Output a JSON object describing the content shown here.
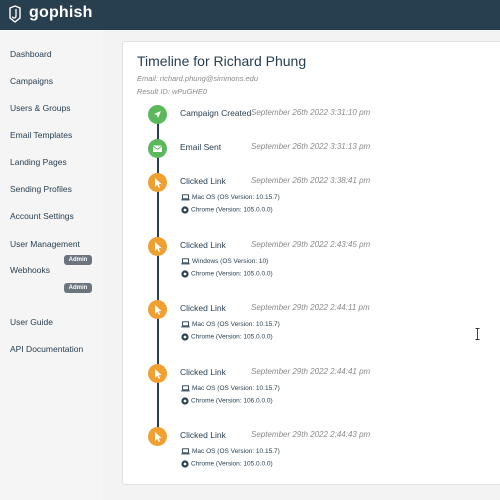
{
  "app": {
    "name": "gophish"
  },
  "sidebar": {
    "items": [
      {
        "label": "Dashboard"
      },
      {
        "label": "Campaigns"
      },
      {
        "label": "Users & Groups"
      },
      {
        "label": "Email Templates"
      },
      {
        "label": "Landing Pages"
      },
      {
        "label": "Sending Profiles"
      },
      {
        "label": "Account Settings"
      },
      {
        "label": "User Management"
      },
      {
        "label": "Webhooks"
      },
      {
        "label": "User Guide"
      },
      {
        "label": "API Documentation"
      }
    ],
    "admin_badge": "Admin"
  },
  "timeline": {
    "title": "Timeline for Richard Phung",
    "email": "Email: richard.phung@simmons.edu",
    "result_id": "Result ID: wPuGHE0",
    "events": [
      {
        "label": "Campaign Created",
        "time": "September 26th 2022 3:31:10 pm",
        "icon": "rocket-icon"
      },
      {
        "label": "Email Sent",
        "time": "September 26th 2022 3:31:13 pm",
        "icon": "envelope-icon"
      },
      {
        "label": "Clicked Link",
        "time": "September 26th 2022 3:38:41 pm",
        "os": "Mac OS (OS Version: 10.15.7)",
        "browser": "Chrome (Version: 105.0.0.0)"
      },
      {
        "label": "Clicked Link",
        "time": "September 29th 2022 2:43:45 pm",
        "os": "Windows (OS Version: 10)",
        "browser": "Chrome (Version: 105.0.0.0)"
      },
      {
        "label": "Clicked Link",
        "time": "September 29th 2022 2:44:11 pm",
        "os": "Mac OS (OS Version: 10.15.7)",
        "browser": "Chrome (Version: 105.0.0.0)"
      },
      {
        "label": "Clicked Link",
        "time": "September 29th 2022 2:44:41 pm",
        "os": "Mac OS (OS Version: 10.15.7)",
        "browser": "Chrome (Version: 106.0.0.0)"
      },
      {
        "label": "Clicked Link",
        "time": "September 29th 2022 2:44:43 pm",
        "os": "Mac OS (OS Version: 10.15.7)",
        "browser": "Chrome (Version: 105.0.0.0)"
      }
    ]
  },
  "colors": {
    "topbar": "#283f50",
    "sent": "#5cb85c",
    "clicked": "#f0a030"
  }
}
